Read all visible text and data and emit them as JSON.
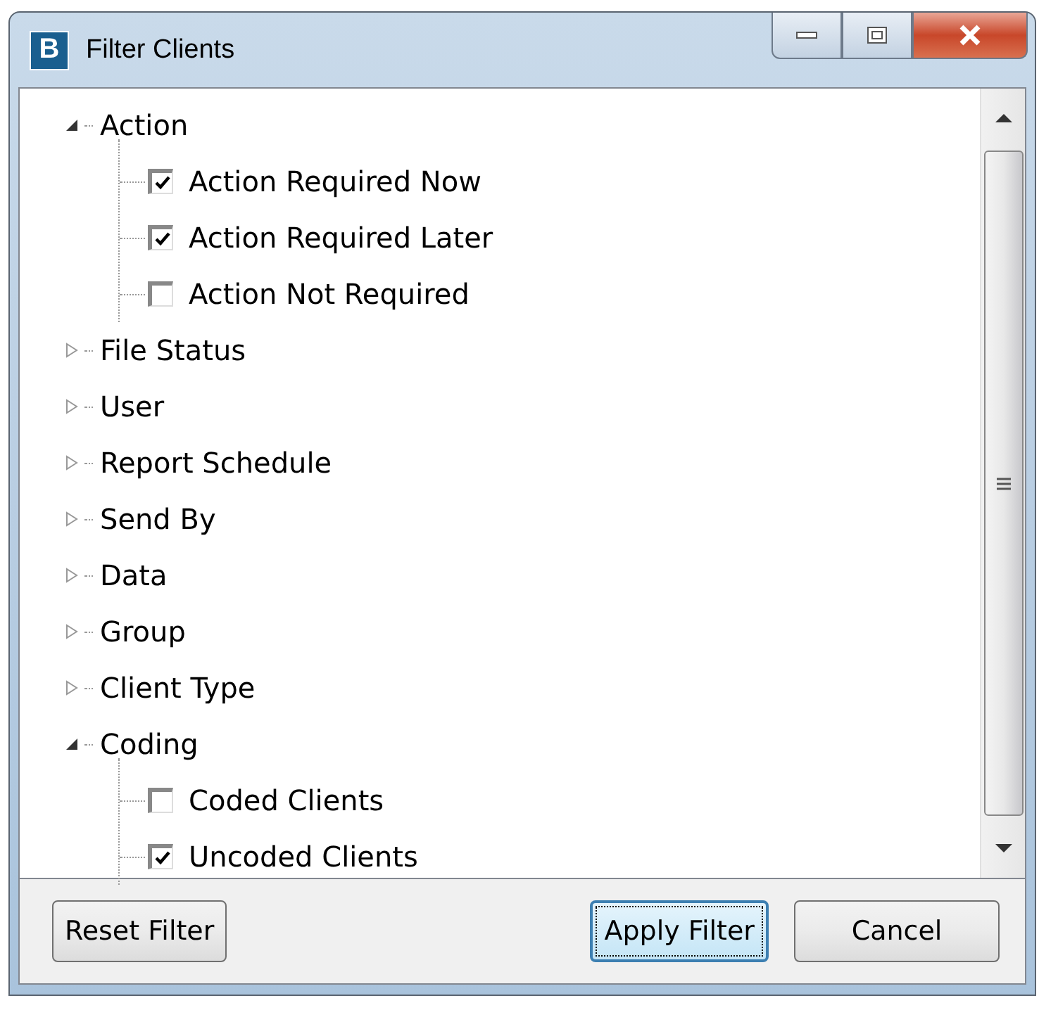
{
  "window": {
    "icon_letter": "B",
    "title": "Filter Clients"
  },
  "tree": [
    {
      "label": "Action",
      "expanded": true,
      "children": [
        {
          "label": "Action Required Now",
          "checked": true
        },
        {
          "label": "Action Required Later",
          "checked": true
        },
        {
          "label": "Action Not Required",
          "checked": false
        }
      ]
    },
    {
      "label": "File Status",
      "expanded": false
    },
    {
      "label": "User",
      "expanded": false
    },
    {
      "label": "Report Schedule",
      "expanded": false
    },
    {
      "label": "Send By",
      "expanded": false
    },
    {
      "label": "Data",
      "expanded": false
    },
    {
      "label": "Group",
      "expanded": false
    },
    {
      "label": "Client Type",
      "expanded": false
    },
    {
      "label": "Coding",
      "expanded": true,
      "children": [
        {
          "label": "Coded Clients",
          "checked": false
        },
        {
          "label": "Uncoded Clients",
          "checked": true
        }
      ]
    }
  ],
  "buttons": [
    {
      "label": "Reset Filter",
      "focused": false
    },
    {
      "label": "Apply Filter",
      "focused": true
    },
    {
      "label": "Cancel",
      "focused": false
    }
  ]
}
